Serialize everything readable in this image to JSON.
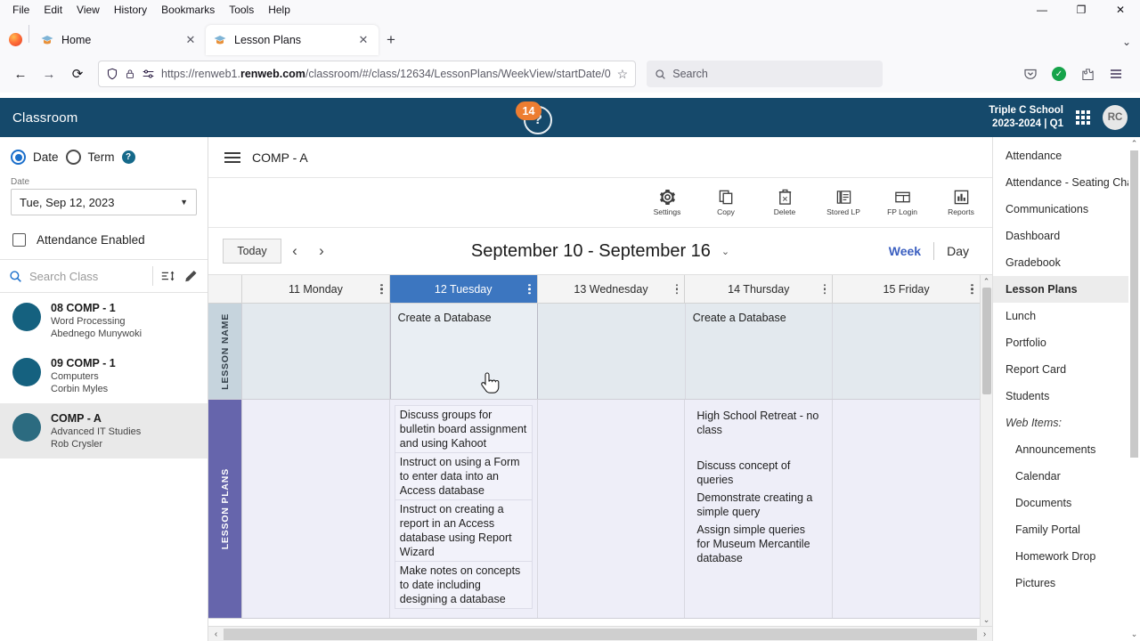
{
  "browser": {
    "menus": [
      "File",
      "Edit",
      "View",
      "History",
      "Bookmarks",
      "Tools",
      "Help"
    ],
    "window_buttons": {
      "minimize": "—",
      "maximize": "❐",
      "close": "✕"
    },
    "tabs": [
      {
        "title": "Home",
        "active": false,
        "favicon": "graduation-cap-icon"
      },
      {
        "title": "Lesson Plans",
        "active": true,
        "favicon": "graduation-cap-icon"
      }
    ],
    "new_tab_label": "+",
    "tab_list_caret": "⌄",
    "nav": {
      "back": "←",
      "forward": "→",
      "reload": "⟳"
    },
    "url": {
      "prefix": "https://renweb1.",
      "domain": "renweb.com",
      "path": "/classroom/#/class/12634/LessonPlans/WeekView/startDate/0"
    },
    "bookmark_star": "☆",
    "search_placeholder": "Search",
    "right_icons": [
      "save-to-pocket-icon",
      "account-verified-icon",
      "extensions-icon",
      "app-menu-icon"
    ]
  },
  "app": {
    "brand": "Classroom",
    "help": {
      "badge": "14",
      "glyph": "?"
    },
    "school": {
      "name": "Triple C School",
      "term": "2023-2024 | Q1"
    },
    "avatar_initials": "RC"
  },
  "left_sidebar": {
    "mode": {
      "date_label": "Date",
      "term_label": "Term",
      "selected": "Date",
      "help_glyph": "?"
    },
    "date_field": {
      "label": "Date",
      "value": "Tue, Sep 12, 2023",
      "caret": "▼"
    },
    "attendance_toggle": {
      "label": "Attendance Enabled",
      "checked": false
    },
    "search": {
      "placeholder": "Search Class",
      "icon": "search-icon",
      "sort_icon": "sort-icon",
      "edit_icon": "pencil-icon"
    },
    "classes": [
      {
        "name": "08 COMP - 1",
        "subject": "Word Processing",
        "teacher": "Abednego Munywoki",
        "selected": false
      },
      {
        "name": "09 COMP - 1",
        "subject": "Computers",
        "teacher": "Corbin Myles",
        "selected": false
      },
      {
        "name": "COMP - A",
        "subject": "Advanced IT Studies",
        "teacher": "Rob Crysler",
        "selected": true
      }
    ]
  },
  "main": {
    "class_title": "COMP - A",
    "menu_icon": "hamburger-icon",
    "toolbar": [
      {
        "label": "Settings",
        "icon": "gear-icon"
      },
      {
        "label": "Copy",
        "icon": "copy-icon"
      },
      {
        "label": "Delete",
        "icon": "trash-icon"
      },
      {
        "label": "Stored LP",
        "icon": "stored-lesson-plan-icon"
      },
      {
        "label": "FP Login",
        "icon": "family-portal-login-icon"
      },
      {
        "label": "Reports",
        "icon": "bar-chart-icon"
      }
    ],
    "datenav": {
      "today_label": "Today",
      "prev": "‹",
      "next": "›",
      "range": "September 10 - September 16",
      "range_caret": "⌄",
      "week_label": "Week",
      "day_label": "Day",
      "active_view": "Week"
    },
    "row_labels": {
      "lesson_name": "LESSON NAME",
      "lesson_plans": "LESSON PLANS"
    },
    "days": [
      {
        "header": "11 Monday",
        "selected": false,
        "lesson_name": "",
        "lesson_plans": []
      },
      {
        "header": "12 Tuesday",
        "selected": true,
        "lesson_name": "Create a Database",
        "lesson_plans": [
          "Discuss groups for bulletin board assignment and using Kahoot",
          "Instruct on using a Form to enter data into an Access database",
          "Instruct on creating a report in an Access database   using Report Wizard",
          "Make notes on concepts to date including designing a database"
        ]
      },
      {
        "header": "13 Wednesday",
        "selected": false,
        "lesson_name": "",
        "lesson_plans": []
      },
      {
        "header": "14 Thursday",
        "selected": false,
        "lesson_name": "Create a Database",
        "lesson_plans": [
          "High School Retreat - no class",
          "",
          "Discuss concept of queries",
          "Demonstrate creating a simple query",
          "Assign simple queries for Museum Mercantile database"
        ]
      },
      {
        "header": "15 Friday",
        "selected": false,
        "lesson_name": "",
        "lesson_plans": []
      }
    ],
    "scroll": {
      "up": "⌃",
      "down": "⌄",
      "left": "‹",
      "right": "›"
    }
  },
  "right_sidebar": {
    "scroll": {
      "up": "⌃",
      "down": "⌄"
    },
    "items": [
      {
        "label": "Attendance",
        "type": "item"
      },
      {
        "label": "Attendance - Seating Chart",
        "type": "item"
      },
      {
        "label": "Communications",
        "type": "item"
      },
      {
        "label": "Dashboard",
        "type": "item"
      },
      {
        "label": "Gradebook",
        "type": "item"
      },
      {
        "label": "Lesson Plans",
        "type": "active"
      },
      {
        "label": "Lunch",
        "type": "item"
      },
      {
        "label": "Portfolio",
        "type": "item"
      },
      {
        "label": "Report Card",
        "type": "item"
      },
      {
        "label": "Students",
        "type": "item"
      },
      {
        "label": "Web Items:",
        "type": "section"
      },
      {
        "label": "Announcements",
        "type": "sub"
      },
      {
        "label": "Calendar",
        "type": "sub"
      },
      {
        "label": "Documents",
        "type": "sub"
      },
      {
        "label": "Family Portal",
        "type": "sub"
      },
      {
        "label": "Homework Drop",
        "type": "sub"
      },
      {
        "label": "Pictures",
        "type": "sub"
      }
    ]
  },
  "colors": {
    "app_header": "#15496b",
    "selected_day": "#3c76c0",
    "lesson_plans_band": "#6665ac",
    "lesson_name_band": "#c6d4dd",
    "badge_orange": "#ed7d31",
    "week_active": "#3b5fc0"
  }
}
